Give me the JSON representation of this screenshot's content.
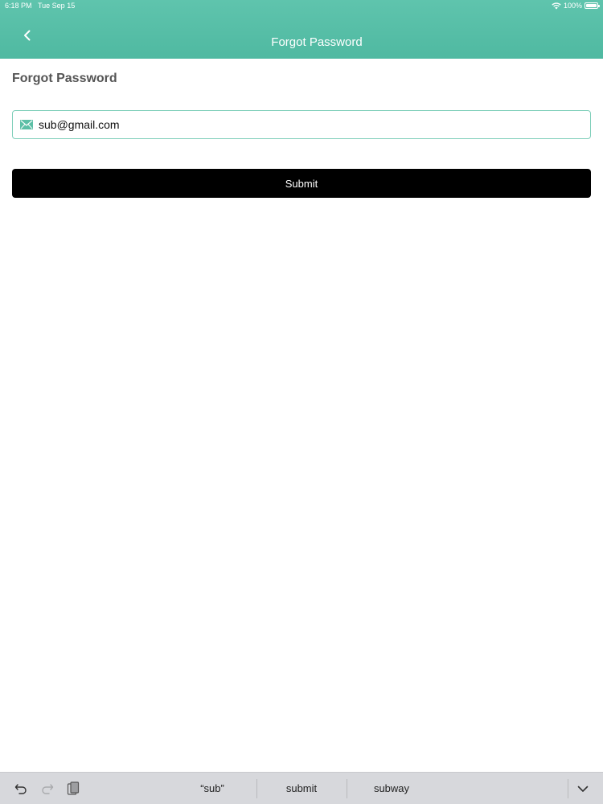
{
  "status_bar": {
    "time": "6:18 PM",
    "date": "Tue Sep 15",
    "battery": "100%"
  },
  "nav": {
    "title": "Forgot Password",
    "back_icon": "chevron-left-icon"
  },
  "main": {
    "heading": "Forgot Password",
    "email": {
      "icon": "envelope-icon",
      "value": "sub@gmail.com"
    },
    "submit_label": "Submit"
  },
  "keyboard": {
    "suggestions": [
      "“sub”",
      "submit",
      "subway"
    ]
  },
  "colors": {
    "header": "#4fb9a1",
    "accent": "#5cbfa6",
    "button": "#000000"
  }
}
